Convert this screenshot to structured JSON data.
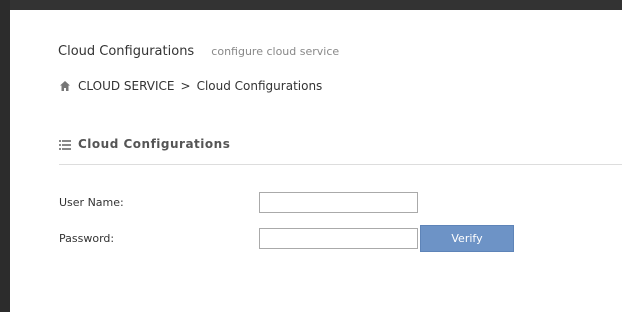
{
  "header": {
    "title": "Cloud Configurations",
    "subtitle": "configure cloud service"
  },
  "breadcrumb": {
    "home_icon": "home-icon",
    "parent": "CLOUD SERVICE",
    "separator": ">",
    "current": "Cloud Configurations"
  },
  "panel": {
    "icon": "list-icon",
    "title": "Cloud Configurations"
  },
  "form": {
    "username_label": "User Name:",
    "username_value": "",
    "password_label": "Password:",
    "password_value": "",
    "verify_label": "Verify"
  },
  "colors": {
    "accent": "#6d93c6",
    "frame": "#333333"
  }
}
